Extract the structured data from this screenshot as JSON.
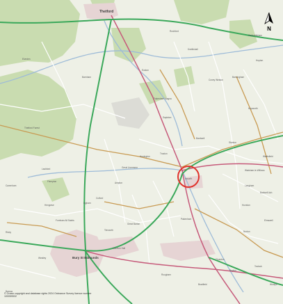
{
  "map": {
    "places": {
      "thetford": "Thetford",
      "bury": "Bury St Edmunds",
      "ixworth": "Ixworth",
      "stanton": "Stanton",
      "walsham": "Walsham-le-Willows",
      "elmswell": "Elmswell",
      "great_barton": "Great Barton",
      "barningham": "Barningham",
      "hepworth": "Hepworth",
      "euston": "Euston",
      "fakenham": "Fakenham Magna",
      "bardwell": "Bardwell",
      "honington": "Honington",
      "norton": "Norton",
      "pakenham": "Pakenham",
      "thurston": "Thurston",
      "ingham": "Ingham",
      "brandon_forest": "Thetford Forest",
      "garboldisham": "Garboldisham",
      "rushford": "Rushford",
      "coney_weston": "Coney Weston",
      "badwell_ash": "Badwell Ash",
      "bradfield": "Bradfield",
      "rougham": "Rougham",
      "fornham": "Fornham All Saints",
      "risby": "Risby",
      "barrow": "Barrow",
      "culford": "Culford",
      "elveden": "Elveden",
      "barnham": "Barnham",
      "knettishall": "Knettishall",
      "hopton": "Hopton",
      "langham": "Langham",
      "hunston": "Hunston",
      "beyton": "Beyton",
      "tostock": "Tostock",
      "woolpit": "Woolpit",
      "great_livermere": "Great Livermere",
      "troston": "Troston",
      "sapiston": "Sapiston",
      "wattisfield": "Wattisfield",
      "westley": "Westley",
      "moreton_hall": "Moreton Hall",
      "flempton": "Flempton",
      "hengrave": "Hengrave",
      "lackford": "Lackford",
      "timworth": "Timworth",
      "ampton": "Ampton",
      "cavenham": "Cavenham"
    },
    "attribution": "© Crown copyright and database rights 2024 Ordnance Survey licence number 100059532",
    "north_label": "N",
    "colors": {
      "background": "#eef0e6",
      "woodland": "#c9dcb0",
      "trunk_road": "#3aa85a",
      "a_road": "#c65a7a",
      "b_road": "#c89a52",
      "minor_road": "#ffffff",
      "river": "#9dbbd8",
      "urban": "#e6d4d4",
      "marker": "#e0322c"
    }
  }
}
